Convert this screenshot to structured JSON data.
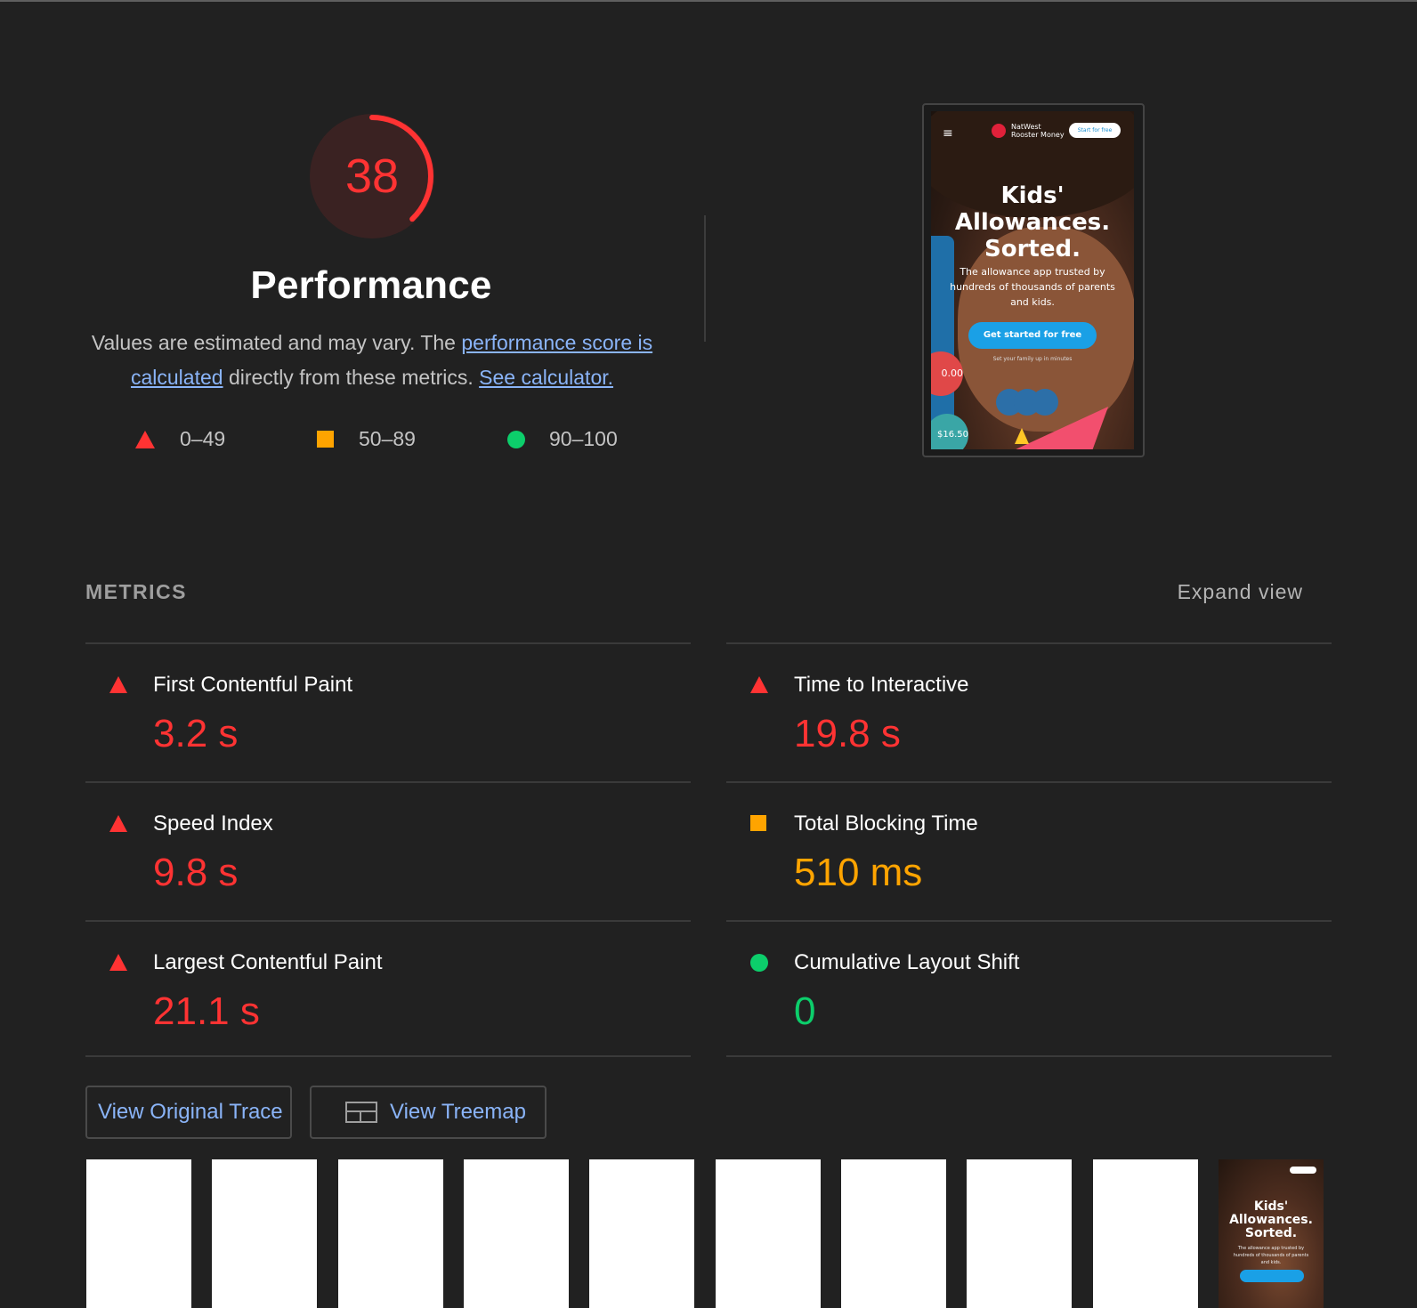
{
  "score": {
    "value": "38",
    "fraction": 0.38,
    "title": "Performance",
    "color": "#ff3333"
  },
  "description": {
    "text_before": "Values are estimated and may vary. The ",
    "link1": "performance score is calculated",
    "text_middle": " directly from these metrics. ",
    "link2": "See calculator."
  },
  "legend": [
    {
      "range": "0–49",
      "icon": "fail-triangle-icon",
      "color": "#ff3333"
    },
    {
      "range": "50–89",
      "icon": "average-square-icon",
      "color": "#ffa400"
    },
    {
      "range": "90–100",
      "icon": "pass-circle-icon",
      "color": "#0cce6b"
    }
  ],
  "screenshot": {
    "menu_icon": "≡",
    "brand_line1": "NatWest",
    "brand_line2": "Rooster Money",
    "start_button": "Start for free",
    "headline": "Kids' Allowances. Sorted.",
    "subtext": "The allowance app trusted by hundreds of thousands of parents and kids.",
    "cta": "Get started for free",
    "small_text": "Set your family up in minutes",
    "bubble1": "0.00",
    "bubble2": "$16.50"
  },
  "metrics": {
    "title": "METRICS",
    "expand_label": "Expand view",
    "items": [
      {
        "label": "First Contentful Paint",
        "value": "3.2 s",
        "status": "fail"
      },
      {
        "label": "Time to Interactive",
        "value": "19.8 s",
        "status": "fail"
      },
      {
        "label": "Speed Index",
        "value": "9.8 s",
        "status": "fail"
      },
      {
        "label": "Total Blocking Time",
        "value": "510 ms",
        "status": "average"
      },
      {
        "label": "Largest Contentful Paint",
        "value": "21.1 s",
        "status": "fail"
      },
      {
        "label": "Cumulative Layout Shift",
        "value": "0",
        "status": "pass"
      }
    ]
  },
  "buttons": {
    "trace": "View Original Trace",
    "treemap": "View Treemap"
  },
  "filmstrip": {
    "last_headline": "Kids' Allowances. Sorted.",
    "last_sub": "The allowance app trusted by hundreds of thousands of parents and kids."
  }
}
